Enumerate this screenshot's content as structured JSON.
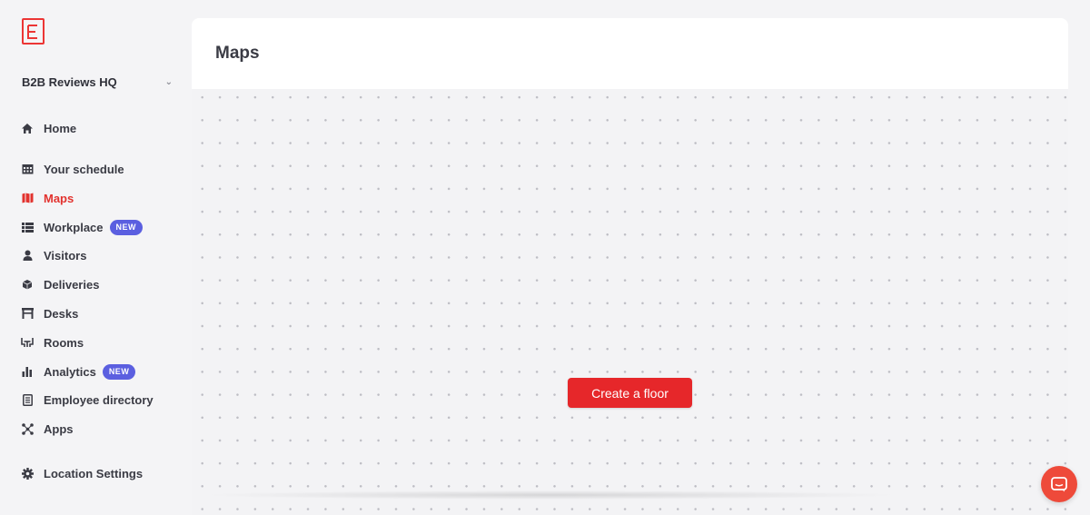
{
  "brand": {
    "icon": "envoy-logo-icon",
    "accent": "#e2322e"
  },
  "location": {
    "name": "B2B Reviews HQ",
    "icon": "chevron-down-icon"
  },
  "nav": [
    {
      "id": "home",
      "label": "Home",
      "icon": "home-icon"
    },
    {
      "id": "schedule",
      "label": "Your schedule",
      "icon": "calendar-icon"
    },
    {
      "id": "maps",
      "label": "Maps",
      "icon": "map-icon",
      "active": true
    },
    {
      "id": "workplace",
      "label": "Workplace",
      "icon": "list-icon",
      "badge": "NEW"
    },
    {
      "id": "visitors",
      "label": "Visitors",
      "icon": "visitor-icon"
    },
    {
      "id": "deliveries",
      "label": "Deliveries",
      "icon": "package-icon"
    },
    {
      "id": "desks",
      "label": "Desks",
      "icon": "desk-icon"
    },
    {
      "id": "rooms",
      "label": "Rooms",
      "icon": "room-icon"
    },
    {
      "id": "analytics",
      "label": "Analytics",
      "icon": "bar-chart-icon",
      "badge": "NEW"
    },
    {
      "id": "directory",
      "label": "Employee directory",
      "icon": "directory-icon"
    },
    {
      "id": "apps",
      "label": "Apps",
      "icon": "apps-icon"
    },
    {
      "id": "location_settings",
      "label": "Location Settings",
      "icon": "gear-icon"
    }
  ],
  "main": {
    "title": "Maps",
    "create_button": "Create a floor"
  },
  "chat": {
    "icon": "chat-icon",
    "color": "#ee4a3a"
  }
}
